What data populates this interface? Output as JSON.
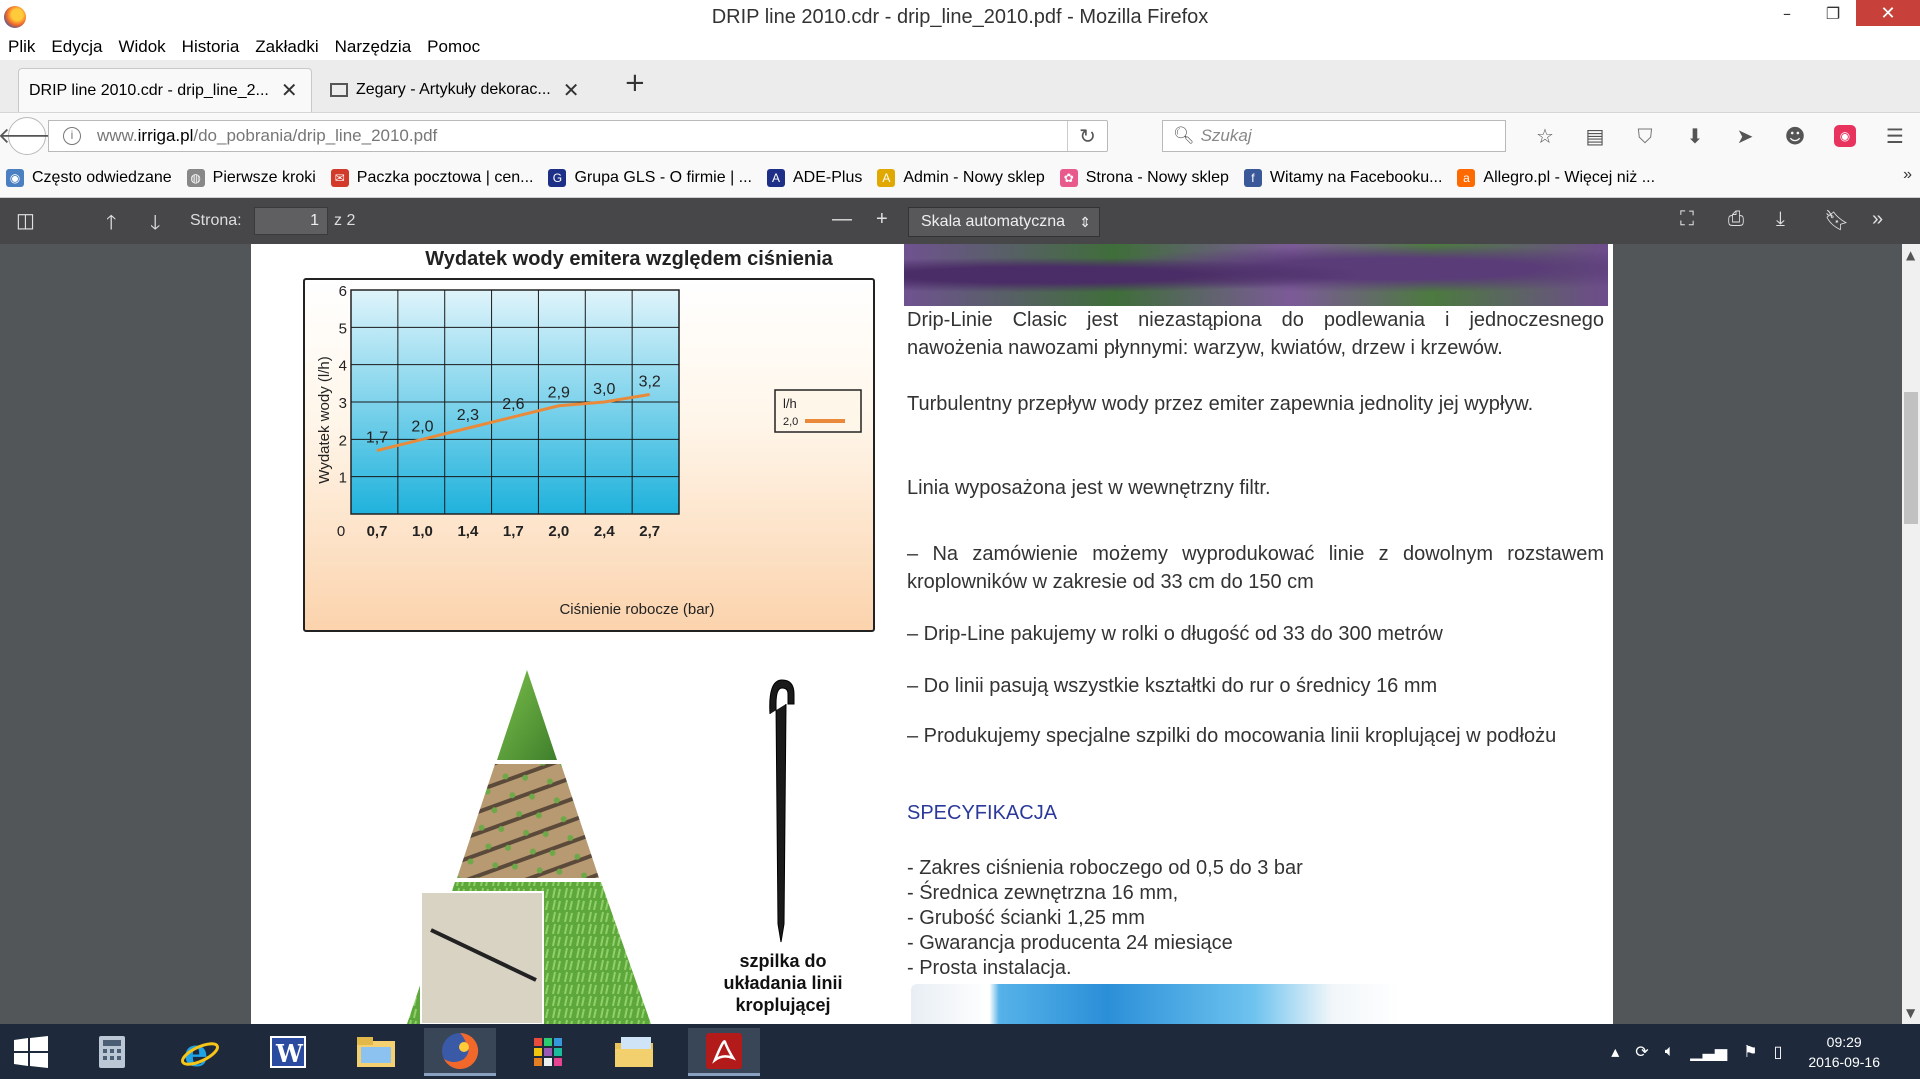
{
  "window": {
    "title": "DRIP line 2010.cdr - drip_line_2010.pdf - Mozilla Firefox",
    "minimize": "–",
    "restore": "❐",
    "close": "✕"
  },
  "menu": [
    "Plik",
    "Edycja",
    "Widok",
    "Historia",
    "Zakładki",
    "Narzędzia",
    "Pomoc"
  ],
  "tabs": [
    {
      "label": "DRIP line 2010.cdr - drip_line_2...",
      "active": true
    },
    {
      "label": "Zegary - Artykuły dekorac...",
      "active": false
    }
  ],
  "new_tab": "+",
  "nav": {
    "url_prefix": "www.",
    "url_domain": "irriga.pl",
    "url_path": "/do_pobrania/drip_line_2010.pdf",
    "search_placeholder": "Szukaj"
  },
  "bookmarks": [
    {
      "label": "Często odwiedzane",
      "icon": "globe-icon",
      "color": "#4a7fc1"
    },
    {
      "label": "Pierwsze kroki",
      "icon": "firefox-icon",
      "color": "#888888"
    },
    {
      "label": "Paczka pocztowa | cen...",
      "icon": "post-icon",
      "color": "#d23a2a"
    },
    {
      "label": "Grupa GLS - O firmie | ...",
      "icon": "gls-icon",
      "color": "#1d2f86"
    },
    {
      "label": "ADE-Plus",
      "icon": "ade-icon",
      "color": "#1d2f86"
    },
    {
      "label": "Admin - Nowy sklep",
      "icon": "admin-icon",
      "color": "#e0a800"
    },
    {
      "label": "Strona - Nowy sklep",
      "icon": "shop-icon",
      "color": "#e85a8c"
    },
    {
      "label": "Witamy na Facebooku...",
      "icon": "facebook-icon",
      "color": "#3b5998"
    },
    {
      "label": "Allegro.pl - Więcej niż ...",
      "icon": "allegro-icon",
      "color": "#ff6a00"
    }
  ],
  "pdf_toolbar": {
    "page_label": "Strona:",
    "page_current": "1",
    "page_total": "z 2",
    "zoom": "Skala automatyczna"
  },
  "chart_data": {
    "type": "line",
    "title": "Wydatek wody emitera względem ciśnienia",
    "xlabel": "Ciśnienie robocze (bar)",
    "ylabel": "Wydatek wody (l/h)",
    "categories": [
      "0,7",
      "1,0",
      "1,4",
      "1,7",
      "2,0",
      "2,4",
      "2,7"
    ],
    "x_origin_label": "0",
    "y_ticks": [
      "1",
      "2",
      "3",
      "4",
      "5",
      "6"
    ],
    "ylim": [
      0,
      6
    ],
    "series": [
      {
        "name": "2,0",
        "values": [
          1.7,
          2.0,
          2.3,
          2.6,
          2.9,
          3.0,
          3.2
        ],
        "labels": [
          "1,7",
          "2,0",
          "2,3",
          "2,6",
          "2,9",
          "3,0",
          "3,2"
        ],
        "color": "#e98a3a"
      }
    ],
    "legend_title": "l/h",
    "legend_position": "right",
    "grid": true
  },
  "pin_caption": "szpilka do układania linii kroplującej",
  "paragraphs": [
    "Drip-Linie Clasic jest niezastąpiona do podlewania i jednoczesnego nawożenia nawozami płynnymi: warzyw, kwiatów, drzew i krzewów.",
    "Turbulentny przepływ wody przez emiter zapewnia jednolity jej wypływ.",
    "Linia wyposażona jest w wewnętrzny filtr.",
    "– Na zamówienie możemy wyprodukować linie z dowolnym rozstawem kroplowników w zakresie od 33 cm do 150  cm",
    "– Drip-Line pakujemy w rolki o długość od 33 do 300 metrów",
    "– Do linii pasują wszystkie kształtki do rur o średnicy 16 mm",
    "– Produkujemy specjalne szpilki do mocowania linii kroplującej w podłożu"
  ],
  "spec_heading": "SPECYFIKACJA",
  "spec_items": [
    "Zakres ciśnienia roboczego od  0,5  do  3  bar",
    "Średnica zewnętrzna 16 mm,",
    "Grubość ścianki 1,25 mm",
    "Gwarancja producenta 24 miesiące",
    "Prosta instalacja."
  ],
  "taskbar": {
    "time": "09:29",
    "date": "2016-09-16",
    "apps": [
      "calculator-icon",
      "internet-explorer-icon",
      "word-icon",
      "file-explorer-icon",
      "firefox-icon",
      "apps-grid-icon",
      "folder-icon",
      "acrobat-icon"
    ]
  }
}
